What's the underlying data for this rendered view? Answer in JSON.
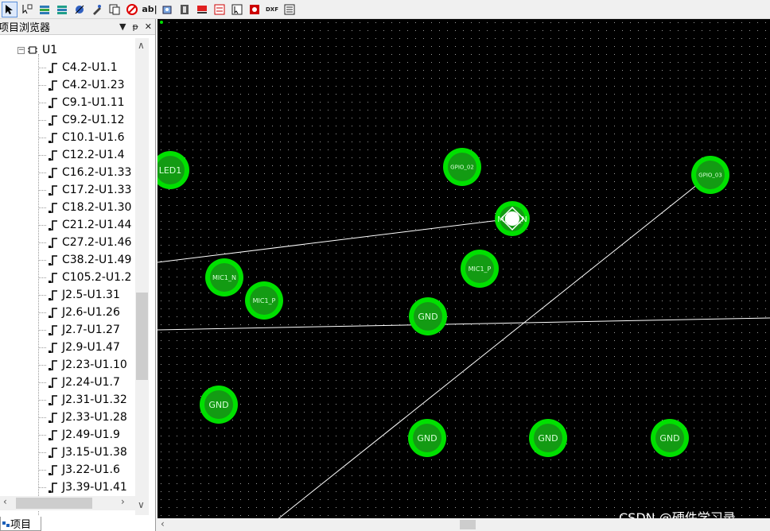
{
  "toolbar": {
    "tools": [
      "pointer-icon",
      "wire-icon",
      "layer-icon",
      "layer2-icon",
      "route-icon",
      "edit-icon",
      "copy-icon",
      "no-entry-icon",
      "text-icon",
      "ab-label",
      "component-icon",
      "film-icon",
      "flag-icon",
      "stack-icon",
      "select-icon",
      "grid-icon",
      "dxf-icon",
      "list-icon"
    ],
    "text_tool_label": "ab|",
    "dxf_label": "DXF"
  },
  "browser": {
    "title": "项目浏览器",
    "pin_icon": "pin-icon",
    "close_icon": "close-icon",
    "root": {
      "expander": "⊟",
      "label": "U1"
    },
    "items": [
      "C4.2-U1.1",
      "C4.2-U1.23",
      "C9.1-U1.11",
      "C9.2-U1.12",
      "C10.1-U1.6",
      "C12.2-U1.4",
      "C16.2-U1.33",
      "C17.2-U1.33",
      "C18.2-U1.30",
      "C21.2-U1.44",
      "C27.2-U1.46",
      "C38.2-U1.49",
      "C105.2-U1.2",
      "J2.5-U1.31",
      "J2.6-U1.26",
      "J2.7-U1.27",
      "J2.9-U1.47",
      "J2.23-U1.10",
      "J2.24-U1.7",
      "J2.31-U1.32",
      "J2.33-U1.28",
      "J2.49-U1.9",
      "J3.15-U1.38",
      "J3.22-U1.6",
      "J3.39-U1.41"
    ],
    "bottom_tab": "项目"
  },
  "canvas": {
    "background": "#000000",
    "pad_color": "#00e000",
    "pads": [
      {
        "label": "LED1"
      },
      {
        "label": "GPIO_02"
      },
      {
        "label": "GPIO_03"
      },
      {
        "label": "MIC1_N"
      },
      {
        "label": "MIC1_P"
      },
      {
        "label": "MIC1_P"
      },
      {
        "label": "GND"
      },
      {
        "label": "GND"
      },
      {
        "label": "GND"
      },
      {
        "label": "GND"
      },
      {
        "label": "GND"
      }
    ],
    "selected_pad_label": "MIC1_N"
  },
  "watermark": "CSDN @硬件学习录"
}
